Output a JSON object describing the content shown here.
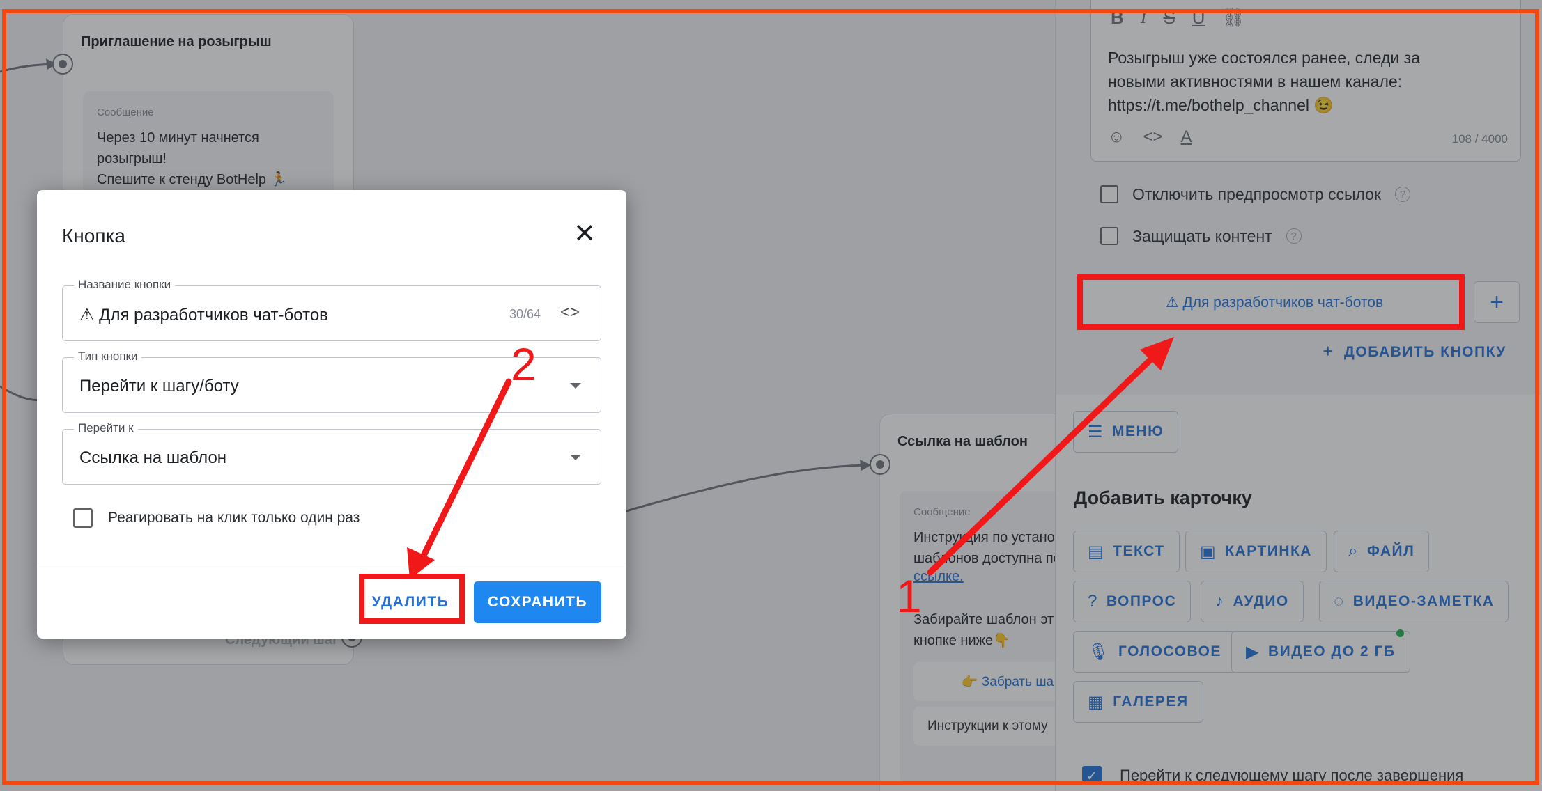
{
  "flow": {
    "node1": {
      "title": "Приглашение на розыгрыш",
      "message_label": "Сообщение",
      "message_text": "Через 10 минут начнется\nрозыгрыш!\nСпешите к стенду BotHelp 🏃",
      "next_step": "Следующий шаг"
    },
    "node2": {
      "title": "Ссылка на шаблон",
      "message_label": "Сообщение",
      "message_text": "Инструкция по устано\nшаблонов доступна по",
      "message_link": "ссылке.",
      "message_text2": "Забирайте шаблон эт\nкнопке ниже👇",
      "button1": "👉 Забрать ша",
      "button2": "Инструкции к этому"
    }
  },
  "panel": {
    "format_icons": [
      "B",
      "I",
      "S",
      "U",
      "link-icon"
    ],
    "message_text": "Розыгрыш уже состоялся ранее, следи за\nновыми активностями в нашем канале:\nhttps://t.me/bothelp_channel 😉",
    "char_counter": "108 / 4000",
    "disable_preview_label": "Отключить предпросмотр ссылок",
    "protect_content_label": "Защищать контент",
    "keyboard_button_label": "⚠ Для разработчиков чат-ботов",
    "add_button_label": "ДОБАВИТЬ КНОПКУ",
    "menu_label": "МЕНЮ",
    "add_card_title": "Добавить карточку",
    "cards": {
      "text": "ТЕКСТ",
      "image": "КАРТИНКА",
      "file": "ФАЙЛ",
      "question": "ВОПРОС",
      "audio": "АУДИО",
      "video_note": "ВИДЕО-ЗАМЕТКА",
      "voice": "ГОЛОСОВОЕ",
      "video": "ВИДЕО ДО 2 ГБ",
      "gallery": "ГАЛЕРЕЯ"
    },
    "next_step_checkbox": "Перейти к следующему шагу после завершения"
  },
  "modal": {
    "title": "Кнопка",
    "name_field": {
      "label": "Название кнопки",
      "value": "⚠ Для разработчиков чат-ботов",
      "counter": "30/64"
    },
    "type_field": {
      "label": "Тип кнопки",
      "value": "Перейти к шагу/боту"
    },
    "goto_field": {
      "label": "Перейти к",
      "value": "Ссылка на шаблон"
    },
    "react_once_label": "Реагировать на клик только один раз",
    "delete_label": "УДАЛИТЬ",
    "save_label": "СОХРАНИТЬ"
  },
  "annotations": {
    "step1": "1",
    "step2": "2"
  },
  "colors": {
    "accent": "#2170d8",
    "primary_button": "#1e88f0",
    "annotation_red": "#f01818",
    "frame_orange": "#f04a12"
  }
}
